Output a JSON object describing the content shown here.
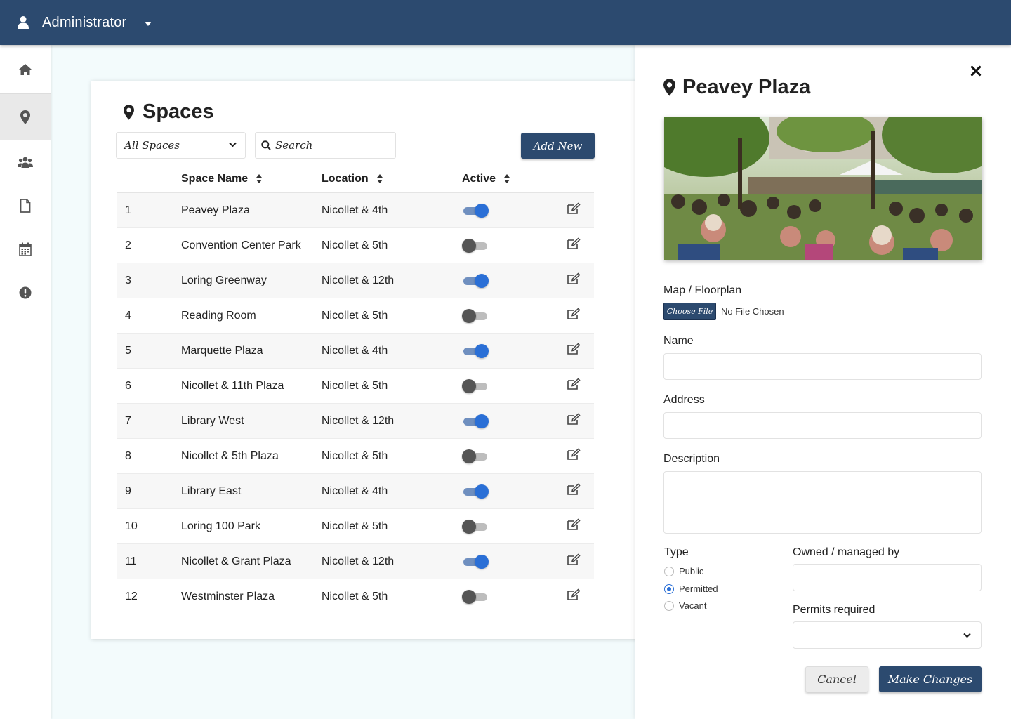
{
  "header": {
    "user_name": "Administrator",
    "user_icon": "user-icon",
    "menu_icon": "caret-down-icon",
    "background_color": "#2c4a6f"
  },
  "sidebar": {
    "items": [
      {
        "icon": "home-icon",
        "active": false
      },
      {
        "icon": "map-marker-icon",
        "active": true
      },
      {
        "icon": "users-icon",
        "active": false
      },
      {
        "icon": "document-icon",
        "active": false
      },
      {
        "icon": "calendar-icon",
        "active": false
      },
      {
        "icon": "alert-icon",
        "active": false
      }
    ]
  },
  "spaces": {
    "title": "Spaces",
    "filter_value": "All Spaces",
    "search_placeholder": "Search",
    "add_new_label": "Add New",
    "columns": {
      "name": "Space Name",
      "location": "Location",
      "active": "Active"
    },
    "rows": [
      {
        "num": "1",
        "name": "Peavey Plaza",
        "location": "Nicollet & 4th",
        "active": true
      },
      {
        "num": "2",
        "name": "Convention Center Park",
        "location": "Nicollet & 5th",
        "active": false
      },
      {
        "num": "3",
        "name": "Loring Greenway",
        "location": "Nicollet & 12th",
        "active": true
      },
      {
        "num": "4",
        "name": "Reading Room",
        "location": "Nicollet & 5th",
        "active": false
      },
      {
        "num": "5",
        "name": "Marquette Plaza",
        "location": "Nicollet & 4th",
        "active": true
      },
      {
        "num": "6",
        "name": "Nicollet & 11th Plaza",
        "location": "Nicollet & 5th",
        "active": false
      },
      {
        "num": "7",
        "name": "Library West",
        "location": "Nicollet & 12th",
        "active": true
      },
      {
        "num": "8",
        "name": "Nicollet & 5th Plaza",
        "location": "Nicollet & 5th",
        "active": false
      },
      {
        "num": "9",
        "name": "Library East",
        "location": "Nicollet & 4th",
        "active": true
      },
      {
        "num": "10",
        "name": "Loring 100 Park",
        "location": "Nicollet & 5th",
        "active": false
      },
      {
        "num": "11",
        "name": "Nicollet & Grant Plaza",
        "location": "Nicollet & 12th",
        "active": true
      },
      {
        "num": "12",
        "name": "Westminster Plaza",
        "location": "Nicollet & 5th",
        "active": false
      }
    ]
  },
  "detail": {
    "title": "Peavey Plaza",
    "map_label": "Map / Floorplan",
    "choose_file_label": "Choose File",
    "file_status": "No File Chosen",
    "name_label": "Name",
    "name_value": "",
    "address_label": "Address",
    "address_value": "",
    "description_label": "Description",
    "description_value": "",
    "type_label": "Type",
    "type_options": [
      {
        "label": "Public",
        "checked": false
      },
      {
        "label": "Permitted",
        "checked": true
      },
      {
        "label": "Vacant",
        "checked": false
      }
    ],
    "owned_label": "Owned / managed by",
    "owned_value": "",
    "permits_label": "Permits required",
    "permits_value": "",
    "cancel_label": "Cancel",
    "submit_label": "Make Changes"
  },
  "colors": {
    "accent": "#2c4a6f",
    "toggle_on": "#2a6fd6",
    "toggle_off": "#555555",
    "page_background": "#f3fbfc"
  }
}
